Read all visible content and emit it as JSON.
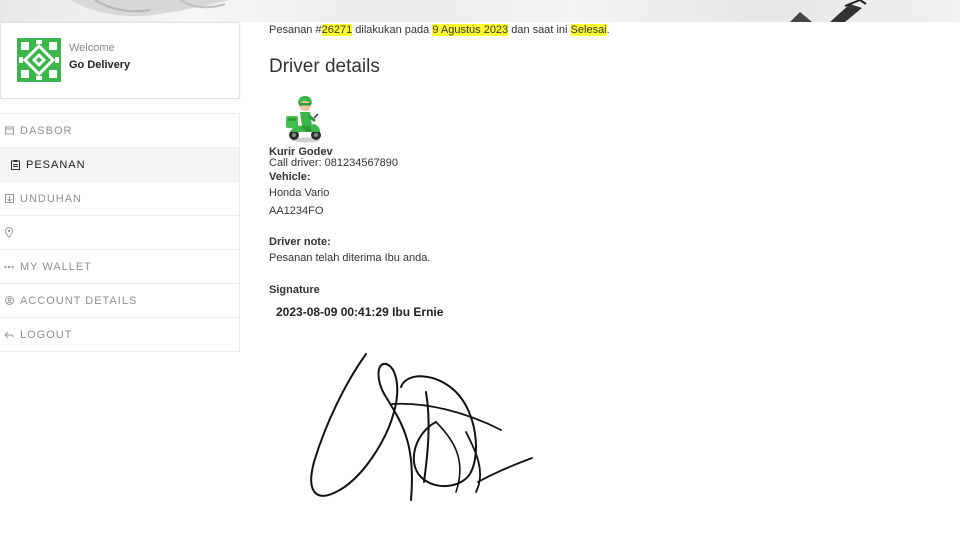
{
  "sidebar": {
    "welcome": "Welcome",
    "username": "Go Delivery",
    "items": [
      {
        "label": "DASBOR",
        "icon": "dashboard-icon"
      },
      {
        "label": "PESANAN",
        "icon": "orders-icon",
        "active": true
      },
      {
        "label": "UNDUHAN",
        "icon": "download-icon"
      },
      {
        "label": "",
        "icon": "location-pin-icon"
      },
      {
        "label": "MY WALLET",
        "icon": "wallet-icon"
      },
      {
        "label": "ACCOUNT DETAILS",
        "icon": "account-icon"
      },
      {
        "label": "LOGOUT",
        "icon": "logout-icon"
      }
    ]
  },
  "order": {
    "prefix": "Pesanan #",
    "number": "26271",
    "mid": " dilakukan pada ",
    "date": "9 Agustus 2023",
    "mid2": " dan saat ini ",
    "status": "Selesai",
    "suffix": "."
  },
  "driver": {
    "title": "Driver details",
    "name": "Kurir Godev",
    "call": "Call driver: 081234567890",
    "vehicle_label": "Vehicle:",
    "vehicle_model": "Honda Vario",
    "vehicle_plate": "AA1234FO",
    "note_label": "Driver note:",
    "note": "Pesanan telah diterima Ibu anda.",
    "signature_label": "Signature",
    "signature_stamp": "2023-08-09 00:41:29 Ibu Ernie"
  },
  "colors": {
    "highlight": "#ffff2e",
    "brand_green": "#3cb54a"
  }
}
